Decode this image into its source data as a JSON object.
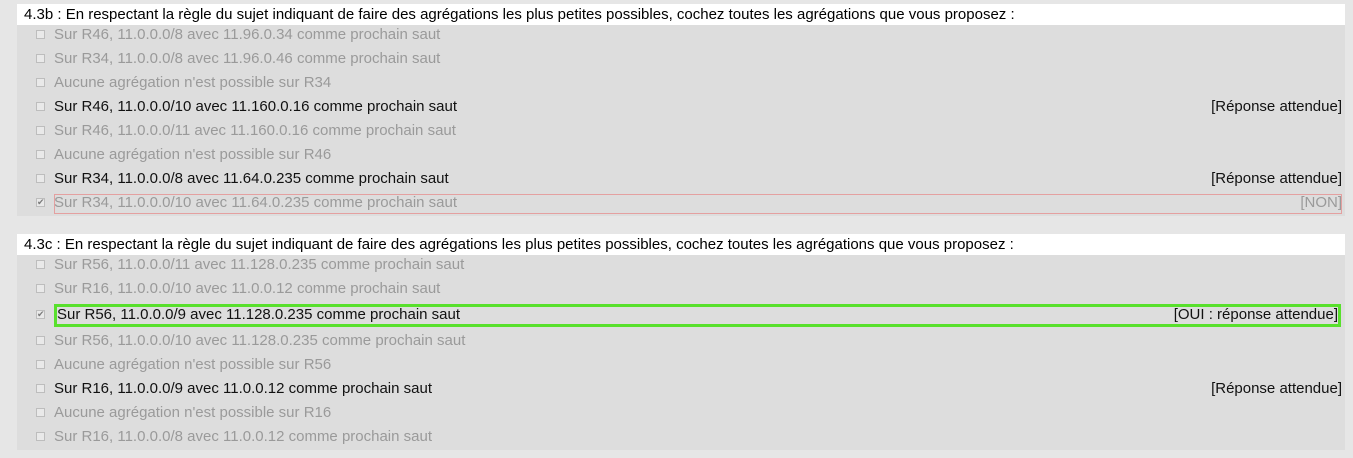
{
  "q1": {
    "title": "4.3b : En respectant la règle du sujet indiquant de faire des agrégations les plus petites possibles, cochez toutes les agrégations que vous proposez :",
    "options": [
      {
        "text": "Sur R46, 11.0.0.0/8 avec 11.96.0.34 comme prochain saut",
        "tag": "",
        "checked": false
      },
      {
        "text": "Sur R34, 11.0.0.0/8 avec 11.96.0.46 comme prochain saut",
        "tag": "",
        "checked": false
      },
      {
        "text": "Aucune agrégation n'est possible sur R34",
        "tag": "",
        "checked": false
      },
      {
        "text": "Sur R46, 11.0.0.0/10 avec 11.160.0.16 comme prochain saut",
        "tag": "[Réponse attendue]",
        "checked": false
      },
      {
        "text": "Sur R46, 11.0.0.0/11 avec 11.160.0.16 comme prochain saut",
        "tag": "",
        "checked": false
      },
      {
        "text": "Aucune agrégation n'est possible sur R46",
        "tag": "",
        "checked": false
      },
      {
        "text": "Sur R34, 11.0.0.0/8 avec 11.64.0.235 comme prochain saut",
        "tag": "[Réponse attendue]",
        "checked": false
      },
      {
        "text": "Sur R34, 11.0.0.0/10 avec 11.64.0.235 comme prochain saut",
        "tag": "[NON]",
        "checked": true
      }
    ]
  },
  "q2": {
    "title": "4.3c : En respectant la règle du sujet indiquant de faire des agrégations les plus petites possibles, cochez toutes les agrégations que vous proposez :",
    "options": [
      {
        "text": "Sur R56, 11.0.0.0/11 avec 11.128.0.235 comme prochain saut",
        "tag": "",
        "checked": false
      },
      {
        "text": "Sur R16, 11.0.0.0/10 avec 11.0.0.12 comme prochain saut",
        "tag": "",
        "checked": false
      },
      {
        "text": "Sur R56, 11.0.0.0/9 avec 11.128.0.235 comme prochain saut",
        "tag": "[OUI : réponse attendue]",
        "checked": true
      },
      {
        "text": "Sur R56, 11.0.0.0/10 avec 11.128.0.235 comme prochain saut",
        "tag": "",
        "checked": false
      },
      {
        "text": "Aucune agrégation n'est possible sur R56",
        "tag": "",
        "checked": false
      },
      {
        "text": "Sur R16, 11.0.0.0/9 avec 11.0.0.12 comme prochain saut",
        "tag": "[Réponse attendue]",
        "checked": false
      },
      {
        "text": "Aucune agrégation n'est possible sur R16",
        "tag": "",
        "checked": false
      },
      {
        "text": "Sur R16, 11.0.0.0/8 avec 11.0.0.12 comme prochain saut",
        "tag": "",
        "checked": false
      }
    ]
  },
  "checkmark_glyph": "✔"
}
